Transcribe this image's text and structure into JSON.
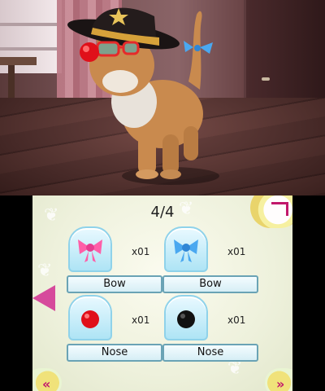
{
  "game": {
    "top_screen": {
      "scene": "cat-in-room",
      "cat_accessories": [
        "sheriff-hat",
        "blue-bow",
        "red-nose",
        "sunglasses"
      ]
    },
    "bottom_screen": {
      "page_indicator": "4/4",
      "items": [
        {
          "label": "Bow",
          "quantity": "x01",
          "icon": "pink-bow-icon",
          "color": "#ff5fa8"
        },
        {
          "label": "Bow",
          "quantity": "x01",
          "icon": "blue-bow-icon",
          "color": "#4aa8f0"
        },
        {
          "label": "Nose",
          "quantity": "x01",
          "icon": "red-nose-icon",
          "color": "#e0101a"
        },
        {
          "label": "Nose",
          "quantity": "x01",
          "icon": "black-nose-icon",
          "color": "#111111"
        }
      ],
      "nav": {
        "back_icon": "back-icon",
        "left_arrow_icon": "arrow-left-icon",
        "prev_icon": "double-chevron-left-icon",
        "next_icon": "double-chevron-right-icon"
      },
      "accent_color": "#d64a9c"
    }
  }
}
